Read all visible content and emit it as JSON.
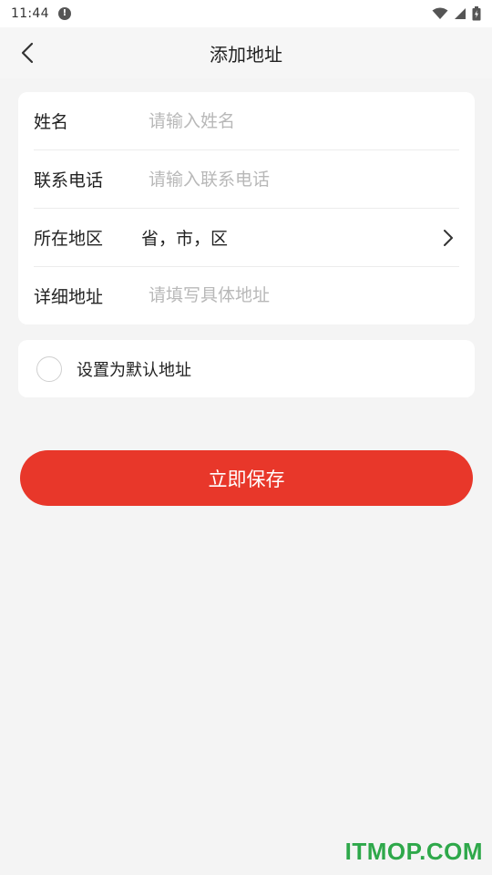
{
  "status_bar": {
    "time": "11:44",
    "alert_glyph": "!",
    "icons": [
      "wifi-icon",
      "signal-icon",
      "battery-icon"
    ]
  },
  "nav": {
    "title": "添加地址",
    "back_icon": "chevron-left-icon"
  },
  "form": {
    "name": {
      "label": "姓名",
      "placeholder": "请输入姓名",
      "value": ""
    },
    "phone": {
      "label": "联系电话",
      "placeholder": "请输入联系电话",
      "value": ""
    },
    "region": {
      "label": "所在地区",
      "value": "省，市，区",
      "icon": "chevron-right-icon"
    },
    "detail": {
      "label": "详细地址",
      "placeholder": "请填写具体地址",
      "value": ""
    }
  },
  "default_option": {
    "label": "设置为默认地址",
    "checked": false
  },
  "save_button": {
    "label": "立即保存"
  },
  "watermark": {
    "text": "ITMOP.COM"
  },
  "colors": {
    "accent": "#e8372a",
    "background": "#f4f4f4",
    "card": "#ffffff",
    "placeholder": "#b8b8b8",
    "watermark": "#2ea84a"
  }
}
